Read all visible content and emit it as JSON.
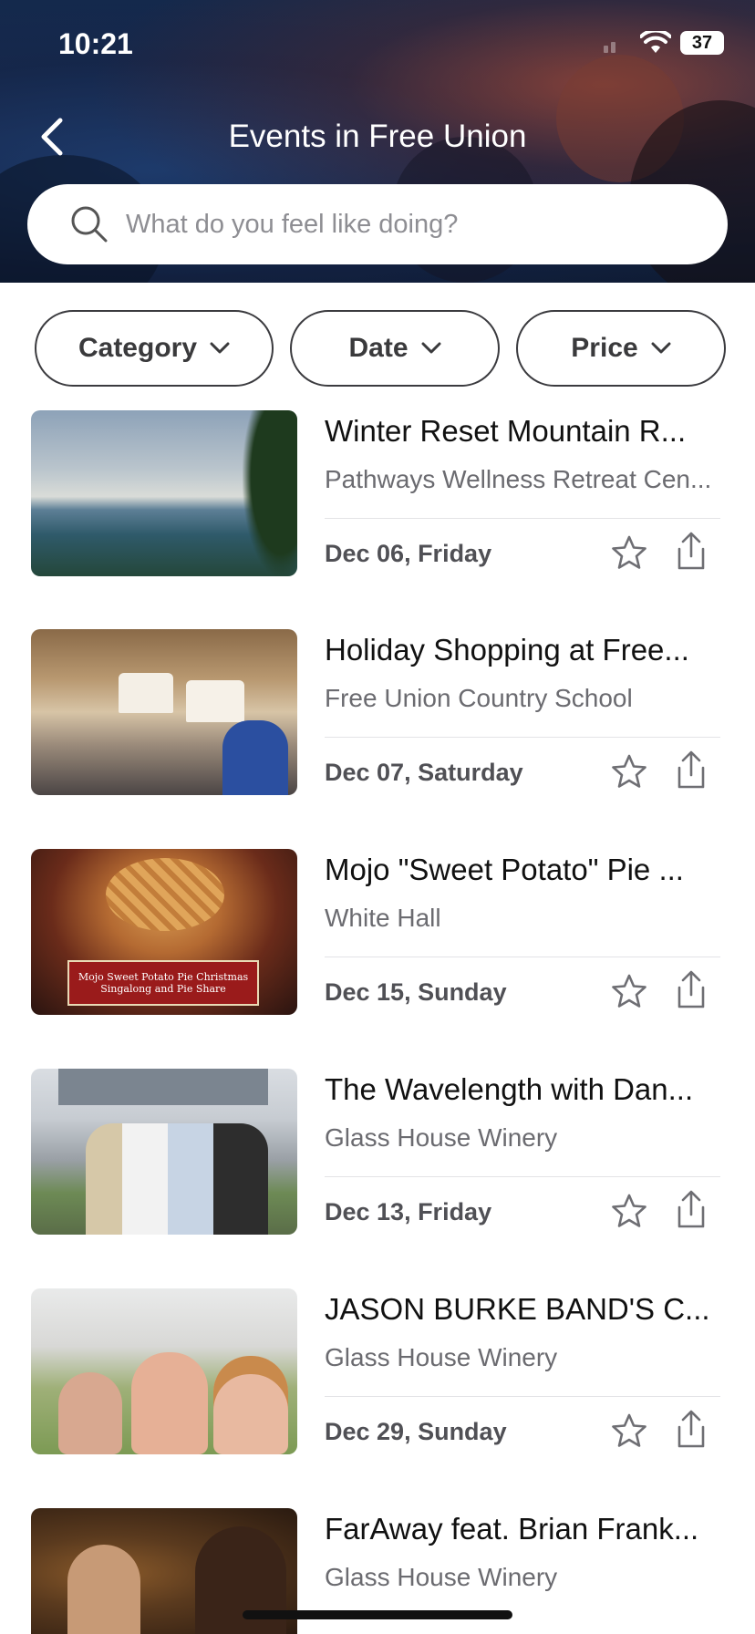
{
  "status": {
    "time": "10:21",
    "battery": "37"
  },
  "header": {
    "title": "Events in Free Union"
  },
  "search": {
    "placeholder": "What do you feel like doing?"
  },
  "filters": [
    {
      "label": "Category"
    },
    {
      "label": "Date"
    },
    {
      "label": "Price"
    }
  ],
  "events": [
    {
      "title": "Winter Reset Mountain R...",
      "venue": "Pathways Wellness Retreat Cen...",
      "date": "Dec 06, Friday"
    },
    {
      "title": "Holiday Shopping at Free...",
      "venue": "Free Union Country School",
      "date": "Dec 07, Saturday"
    },
    {
      "title": "Mojo \"Sweet Potato\" Pie ...",
      "venue": "White Hall",
      "date": "Dec 15, Sunday",
      "image_caption": "Mojo Sweet Potato Pie Christmas Singalong and Pie Share"
    },
    {
      "title": "The Wavelength with Dan...",
      "venue": "Glass House Winery",
      "date": "Dec 13, Friday"
    },
    {
      "title": "JASON BURKE BAND'S C...",
      "venue": "Glass House Winery",
      "date": "Dec 29, Sunday"
    },
    {
      "title": "FarAway feat. Brian Frank...",
      "venue": "Glass House Winery",
      "date": ""
    }
  ],
  "icons": {
    "back": "chevron-left-icon",
    "search": "search-icon",
    "filter_chevron": "chevron-down-icon",
    "favorite": "star-icon",
    "share": "share-icon"
  }
}
